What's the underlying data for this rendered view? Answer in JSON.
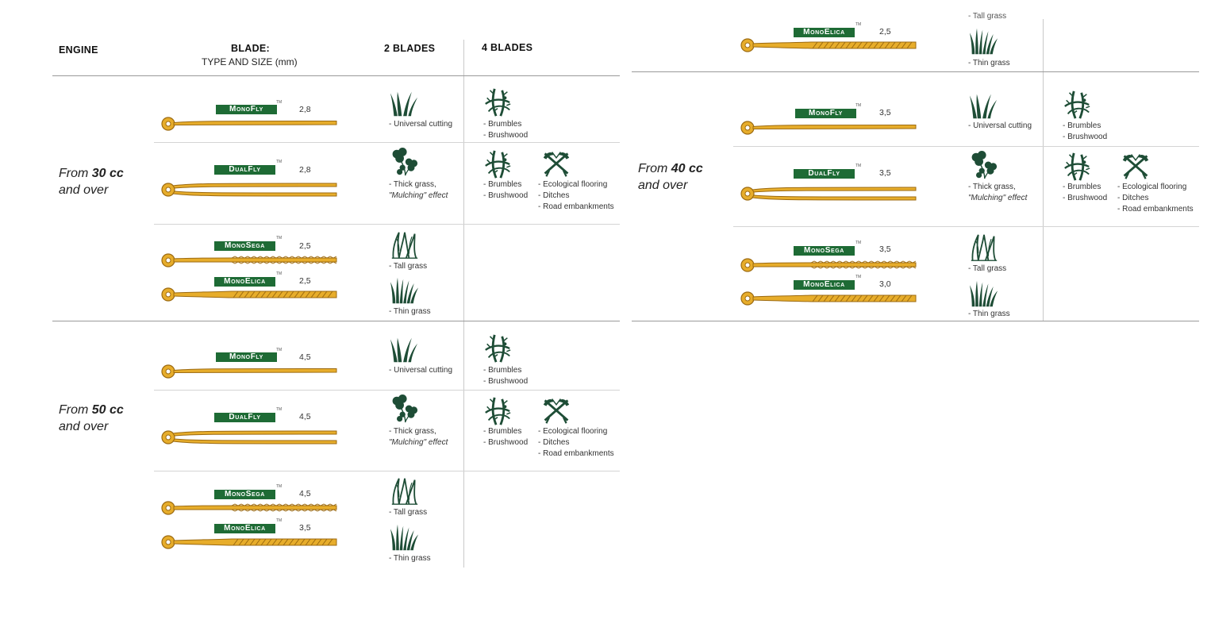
{
  "header": {
    "engine": "ENGINE",
    "blade_title": "BLADE:",
    "blade_sub": "TYPE AND SIZE (mm)",
    "two_blades": "2 BLADES",
    "four_blades": "4 BLADES"
  },
  "engines": {
    "e30": {
      "pre": "From ",
      "cc": "30 cc",
      "post": "and over"
    },
    "e50": {
      "pre": "From ",
      "cc": "50 cc",
      "post": "and over"
    },
    "e40": {
      "pre": "From ",
      "cc": "40 cc",
      "post": "and over"
    }
  },
  "blades": {
    "mono_fly": "MonoFly",
    "dual_fly": "DualFly",
    "mono_sega": "MonoSega",
    "mono_elica": "MonoElica",
    "tm": "TM"
  },
  "sizes": {
    "s28a": "2,8",
    "s28b": "2,8",
    "s25a": "2,5",
    "s25b": "2,5",
    "s45a": "4,5",
    "s45b": "4,5",
    "s45c": "4,5",
    "s35a": "3,5",
    "r25": "2,5",
    "r35a": "3,5",
    "r35b": "3,5",
    "r35c": "3,5",
    "r30": "3,0"
  },
  "uses": {
    "universal": "- Universal cutting",
    "thick": "- Thick grass,",
    "mulching": "\"Mulching\" effect",
    "tall": "- Tall grass",
    "thin": "- Thin grass",
    "brumbles": "- Brumbles",
    "brushwood": "- Brushwood",
    "eco": "- Ecological flooring",
    "ditches": "- Ditches",
    "road": "- Road embankments",
    "tall_cut": "- Tall grass"
  },
  "icons": [
    "grass-blades-icon",
    "clover-icon",
    "tall-grass-icon",
    "thin-grass-icon",
    "bramble-icon",
    "crossed-tools-icon"
  ],
  "colors": {
    "badge": "#1e6b35",
    "blade_fill": "#e7ad2b",
    "blade_stroke": "#9c6a10",
    "icon": "#1e4d36"
  }
}
